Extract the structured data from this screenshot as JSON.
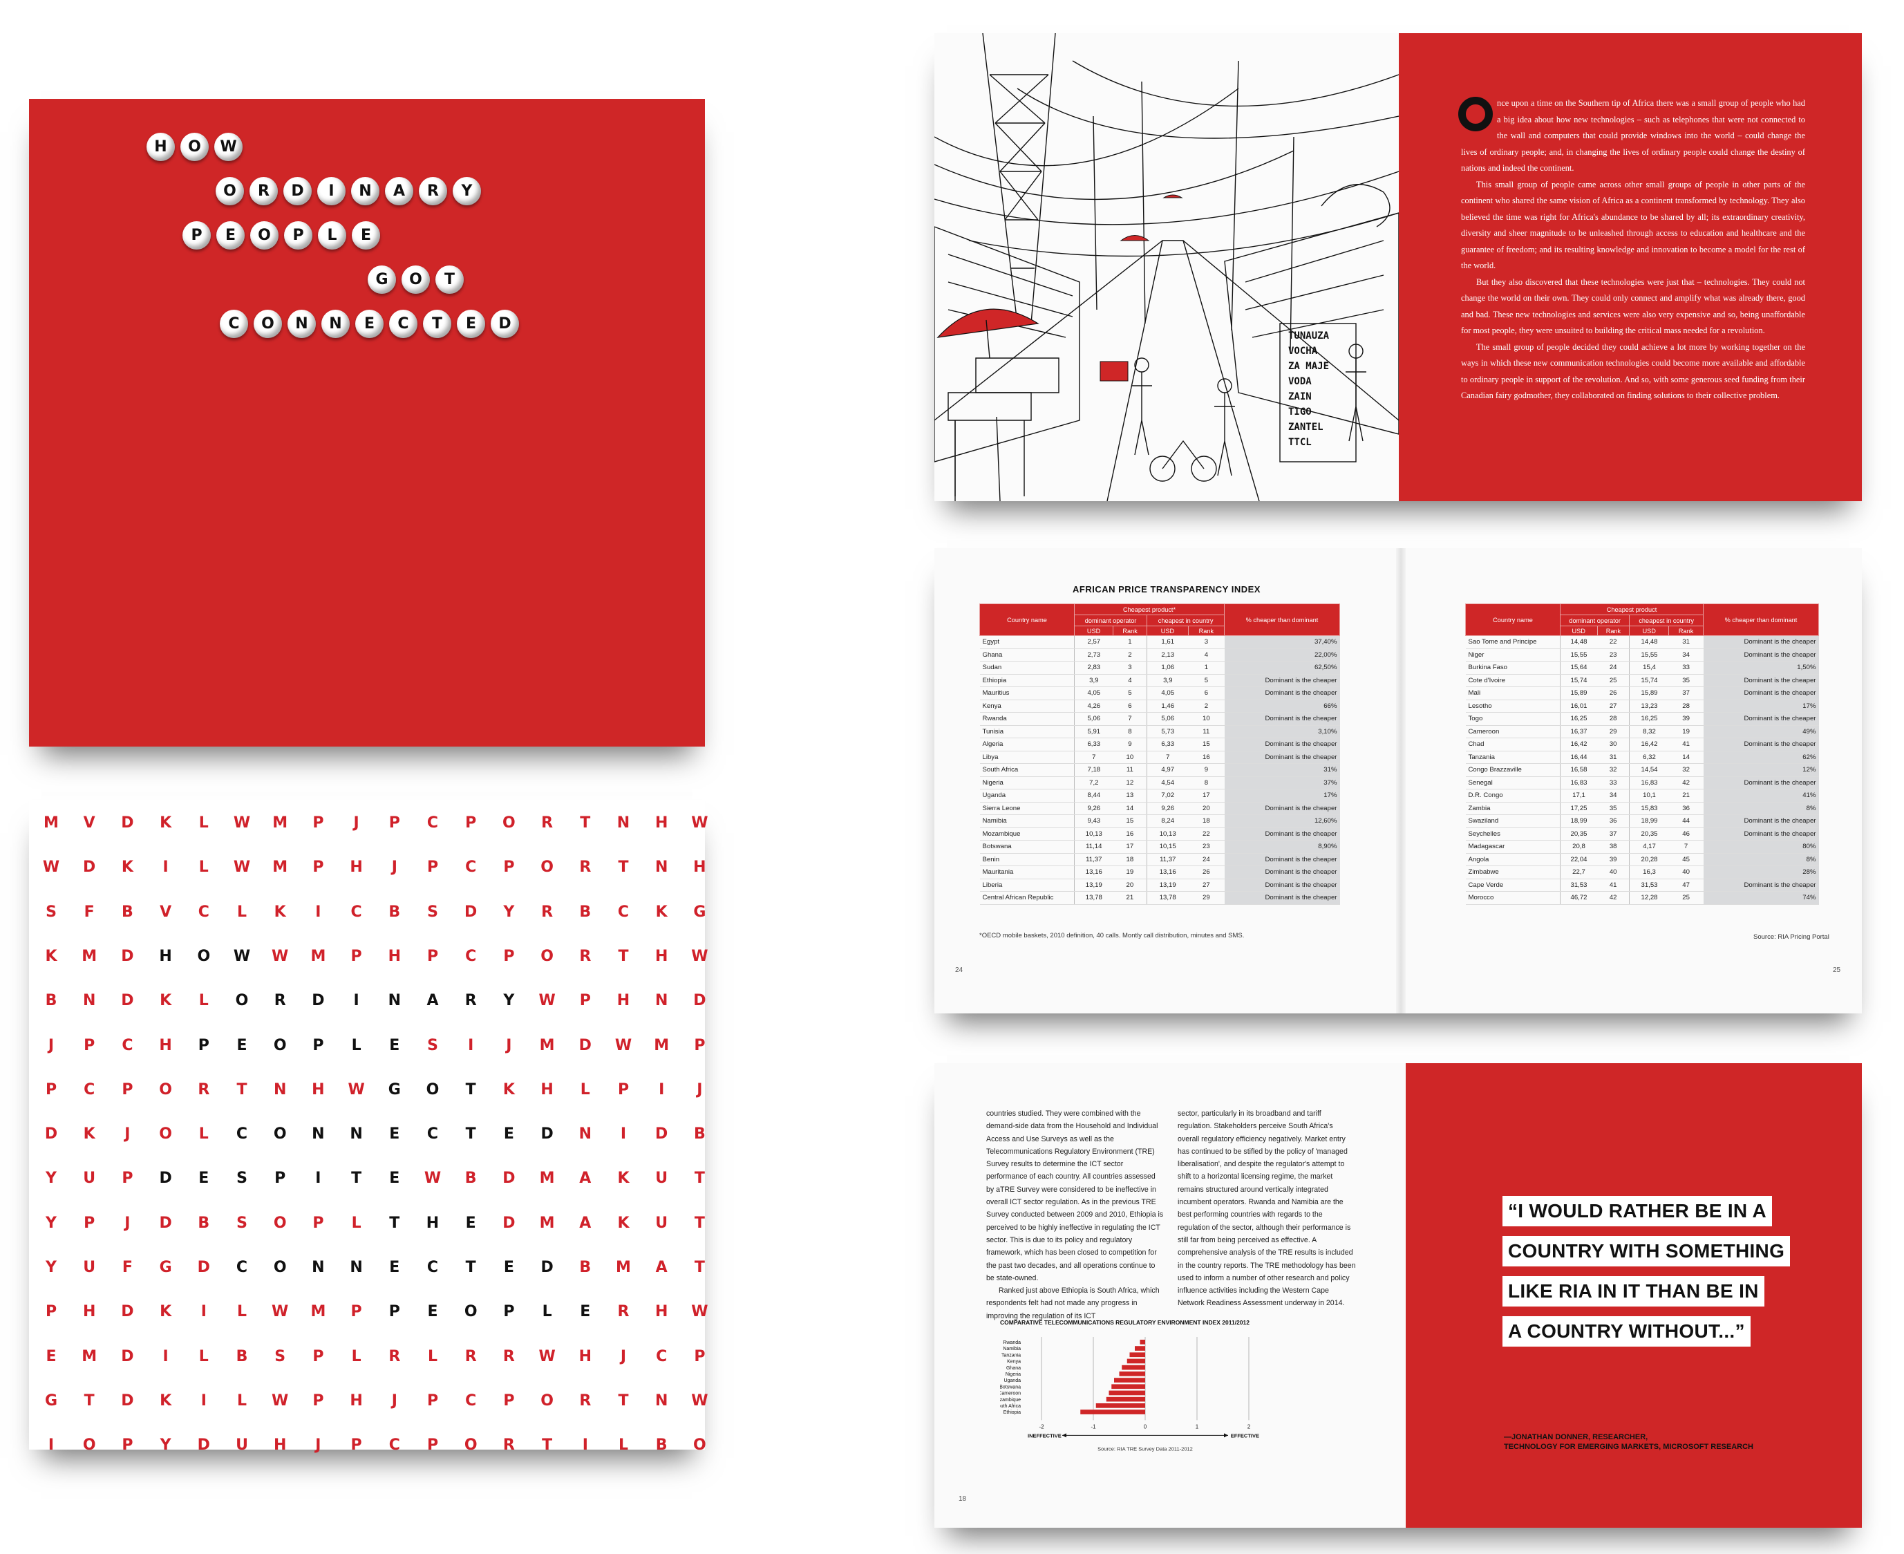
{
  "cover": {
    "title_lines": [
      "HOW",
      "ORDINARY",
      "PEOPLE",
      "GOT",
      "CONNECTED"
    ]
  },
  "wordsearch": {
    "rows": [
      "MVDKLWMPJPCPORTNHW",
      "WDKILWMPHJPCPORTNH",
      "SFBVCLKICBSDYRBCKG",
      "KMDHOWWMPHPCPORTHW",
      "BNDKLORDINARYWPHND",
      "JPCHPEOPLESIJMDWMP",
      "PCPORTNHWGOTKHLPIJ",
      "DKJOLCONNECTEDNIDB",
      "YUPDESPITEWBDMAKUT",
      "YPJDBSOPLTHEDMAKUT",
      "YUFGDCONNECTEDBMAT",
      "PHDKILWMPPEOPLERHW",
      "EMDILBSPLRLRRWHJCP",
      "GTDKILWPHJPCPORTNW",
      "IOPYDUHJPCPORTILBO"
    ],
    "black_words": [
      {
        "row": 3,
        "start": 3,
        "len": 3
      },
      {
        "row": 4,
        "start": 5,
        "len": 8
      },
      {
        "row": 5,
        "start": 4,
        "len": 6
      },
      {
        "row": 6,
        "start": 9,
        "len": 3
      },
      {
        "row": 7,
        "start": 5,
        "len": 9
      },
      {
        "row": 8,
        "start": 3,
        "len": 7
      },
      {
        "row": 9,
        "start": 9,
        "len": 3
      },
      {
        "row": 10,
        "start": 5,
        "len": 9
      },
      {
        "row": 11,
        "start": 9,
        "len": 6
      }
    ]
  },
  "story": {
    "dropcap_letter": "O",
    "paragraphs": [
      "nce upon a time on the Southern tip of Africa there was a small group of people who had a big idea about how new technologies – such as telephones that were not connected to the wall and computers that could provide windows into the world – could change the lives of ordinary people; and, in changing the lives of ordinary people could change the destiny of nations and indeed the continent.",
      "This small group of people came across other small groups of people in other parts of the continent who shared the same vision of Africa as a continent transformed by technology. They also believed the time was right for Africa's abundance to be shared by all; its extraordinary creativity, diversity and sheer magnitude to be unleashed through access to education and healthcare and the guarantee of freedom; and its resulting knowledge and innovation to become a model for the rest of the world.",
      "But they also discovered that these technologies were just that – technologies. They could not change the world on their own. They could only connect and amplify what was already there, good and bad. These new technologies and services were also very expensive and so, being unaffordable for most people, they were unsuited to building the critical mass needed for a revolution.",
      "The small group of people decided they could achieve a lot more by working together on the ways in which these new communication technologies could become more available and affordable to ordinary people in support of the revolution. And so, with some generous seed funding from their Canadian fairy godmother, they collaborated on finding solutions to their collective problem."
    ]
  },
  "illustration": {
    "sign_lines": [
      "TUNAUZA",
      "VOCHA",
      "ZA MAJE",
      "VODA",
      "ZAIN",
      "TIGO",
      "ZANTEL",
      "TTCL"
    ]
  },
  "price_index": {
    "title": "AFRICAN PRICE TRANSPARENCY INDEX",
    "headers": {
      "country": "Country name",
      "cheapest_left": "Cheapest product*",
      "cheapest_right": "Cheapest product",
      "dominant": "dominant operator",
      "cheapest_in_country": "cheapest in country",
      "usd": "USD",
      "rank": "Rank",
      "pct": "% cheaper than dominant"
    },
    "left_rows": [
      [
        "Egypt",
        "2,57",
        "1",
        "1,61",
        "3",
        "37,40%"
      ],
      [
        "Ghana",
        "2,73",
        "2",
        "2,13",
        "4",
        "22,00%"
      ],
      [
        "Sudan",
        "2,83",
        "3",
        "1,06",
        "1",
        "62,50%"
      ],
      [
        "Ethiopia",
        "3,9",
        "4",
        "3,9",
        "5",
        "Dominant is the cheaper"
      ],
      [
        "Mauritius",
        "4,05",
        "5",
        "4,05",
        "6",
        "Dominant is the cheaper"
      ],
      [
        "Kenya",
        "4,26",
        "6",
        "1,46",
        "2",
        "66%"
      ],
      [
        "Rwanda",
        "5,06",
        "7",
        "5,06",
        "10",
        "Dominant is the cheaper"
      ],
      [
        "Tunisia",
        "5,91",
        "8",
        "5,73",
        "11",
        "3,10%"
      ],
      [
        "Algeria",
        "6,33",
        "9",
        "6,33",
        "15",
        "Dominant is the cheaper"
      ],
      [
        "Libya",
        "7",
        "10",
        "7",
        "16",
        "Dominant is the cheaper"
      ],
      [
        "South Africa",
        "7,18",
        "11",
        "4,97",
        "9",
        "31%"
      ],
      [
        "Nigeria",
        "7,2",
        "12",
        "4,54",
        "8",
        "37%"
      ],
      [
        "Uganda",
        "8,44",
        "13",
        "7,02",
        "17",
        "17%"
      ],
      [
        "Sierra Leone",
        "9,26",
        "14",
        "9,26",
        "20",
        "Dominant is the cheaper"
      ],
      [
        "Namibia",
        "9,43",
        "15",
        "8,24",
        "18",
        "12,60%"
      ],
      [
        "Mozambique",
        "10,13",
        "16",
        "10,13",
        "22",
        "Dominant is the cheaper"
      ],
      [
        "Botswana",
        "11,14",
        "17",
        "10,15",
        "23",
        "8,90%"
      ],
      [
        "Benin",
        "11,37",
        "18",
        "11,37",
        "24",
        "Dominant is the cheaper"
      ],
      [
        "Mauritania",
        "13,16",
        "19",
        "13,16",
        "26",
        "Dominant is the cheaper"
      ],
      [
        "Liberia",
        "13,19",
        "20",
        "13,19",
        "27",
        "Dominant is the cheaper"
      ],
      [
        "Central African Republic",
        "13,78",
        "21",
        "13,78",
        "29",
        "Dominant is the cheaper"
      ]
    ],
    "right_rows": [
      [
        "Sao Tome and Principe",
        "14,48",
        "22",
        "14,48",
        "31",
        "Dominant is the cheaper"
      ],
      [
        "Niger",
        "15,55",
        "23",
        "15,55",
        "34",
        "Dominant is the cheaper"
      ],
      [
        "Burkina Faso",
        "15,64",
        "24",
        "15,4",
        "33",
        "1,50%"
      ],
      [
        "Cote d'Ivoire",
        "15,74",
        "25",
        "15,74",
        "35",
        "Dominant is the cheaper"
      ],
      [
        "Mali",
        "15,89",
        "26",
        "15,89",
        "37",
        "Dominant is the cheaper"
      ],
      [
        "Lesotho",
        "16,01",
        "27",
        "13,23",
        "28",
        "17%"
      ],
      [
        "Togo",
        "16,25",
        "28",
        "16,25",
        "39",
        "Dominant is the cheaper"
      ],
      [
        "Cameroon",
        "16,37",
        "29",
        "8,32",
        "19",
        "49%"
      ],
      [
        "Chad",
        "16,42",
        "30",
        "16,42",
        "41",
        "Dominant is the cheaper"
      ],
      [
        "Tanzania",
        "16,44",
        "31",
        "6,32",
        "14",
        "62%"
      ],
      [
        "Congo Brazzaville",
        "16,58",
        "32",
        "14,54",
        "32",
        "12%"
      ],
      [
        "Senegal",
        "16,83",
        "33",
        "16,83",
        "42",
        "Dominant is the cheaper"
      ],
      [
        "D.R. Congo",
        "17,1",
        "34",
        "10,1",
        "21",
        "41%"
      ],
      [
        "Zambia",
        "17,25",
        "35",
        "15,83",
        "36",
        "8%"
      ],
      [
        "Swaziland",
        "18,99",
        "36",
        "18,99",
        "44",
        "Dominant is the cheaper"
      ],
      [
        "Seychelles",
        "20,35",
        "37",
        "20,35",
        "46",
        "Dominant is the cheaper"
      ],
      [
        "Madagascar",
        "20,8",
        "38",
        "4,17",
        "7",
        "80%"
      ],
      [
        "Angola",
        "22,04",
        "39",
        "20,28",
        "45",
        "8%"
      ],
      [
        "Zimbabwe",
        "22,7",
        "40",
        "16,3",
        "40",
        "28%"
      ],
      [
        "Cape Verde",
        "31,53",
        "41",
        "31,53",
        "47",
        "Dominant is the cheaper"
      ],
      [
        "Morocco",
        "46,72",
        "42",
        "12,28",
        "25",
        "74%"
      ]
    ],
    "footnote": "*OECD mobile baskets, 2010 definition, 40 calls. Montly call distribution, minutes and SMS.",
    "source": "Source: RIA Pricing Portal",
    "page_left": "24",
    "page_right": "25"
  },
  "tre": {
    "col1": [
      "countries studied. They were combined with the demand-side data from the Household and Individual Access and Use Surveys as well as the Telecommunications Regulatory Environment (TRE) Survey results to determine the ICT sector performance of each country. All countries assessed by aTRE Survey were considered to be ineffective in overall ICT sector regulation. As in the previous TRE Survey conducted between 2009 and 2010, Ethiopia is perceived to be highly ineffective in regulating the ICT sector. This is due to its policy and regulatory framework, which has been closed to competition for the past two decades, and all operations continue to be state-owned.",
      "Ranked just above Ethiopia is South Africa, which respondents felt had not made any progress in improving the regulation of its ICT"
    ],
    "col2": [
      "sector, particularly in its broadband and tariff regulation. Stakeholders perceive South Africa's overall regulatory efficiency negatively. Market entry has continued to be stifled by the policy of 'managed liberalisation', and despite the regulator's attempt to shift to a horizontal licensing regime, the market remains structured around vertically integrated incumbent operators. Rwanda and Namibia are the best performing countries with regards to the regulation of the sector, although their performance is still far from being perceived as effective. A comprehensive analysis of the TRE results is included in the country reports. The TRE methodology has been used to inform a number of other research and policy influence activities including the Western Cape Network Readiness Assessment underway in 2014."
    ],
    "page_number": "18",
    "chart_title": "COMPARATIVE TELECOMMUNICATIONS REGULATORY ENVIRONMENT INDEX 2011/2012",
    "ineffective_label": "INEFFECTIVE",
    "effective_label": "EFFECTIVE",
    "source": "Source: RIA TRE Survey Data 2011-2012"
  },
  "quote": {
    "lines": [
      "“I WOULD RATHER BE IN A",
      "COUNTRY WITH SOMETHING",
      "LIKE RIA IN IT THAN BE IN",
      "A COUNTRY WITHOUT...”"
    ],
    "attribution_lines": [
      "—JONATHAN DONNER, RESEARCHER,",
      "TECHNOLOGY FOR EMERGING MARKETS, MICROSOFT RESEARCH"
    ]
  },
  "chart_data": {
    "type": "bar",
    "title": "COMPARATIVE TELECOMMUNICATIONS REGULATORY ENVIRONMENT INDEX 2011/2012",
    "orientation": "horizontal",
    "categories": [
      "Rwanda",
      "Namibia",
      "Tanzania",
      "Kenya",
      "Ghana",
      "Nigeria",
      "Uganda",
      "Botswana",
      "Cameroon",
      "Mozambique",
      "South Africa",
      "Ethiopia"
    ],
    "values": [
      -0.1,
      -0.2,
      -0.3,
      -0.35,
      -0.45,
      -0.5,
      -0.6,
      -0.65,
      -0.7,
      -0.75,
      -0.95,
      -1.25
    ],
    "xlim": [
      -2,
      2
    ],
    "x_ticks": [
      -2,
      -1,
      0,
      1,
      2
    ],
    "xlabel_left": "INEFFECTIVE",
    "xlabel_right": "EFFECTIVE",
    "color": "#cf2627"
  }
}
